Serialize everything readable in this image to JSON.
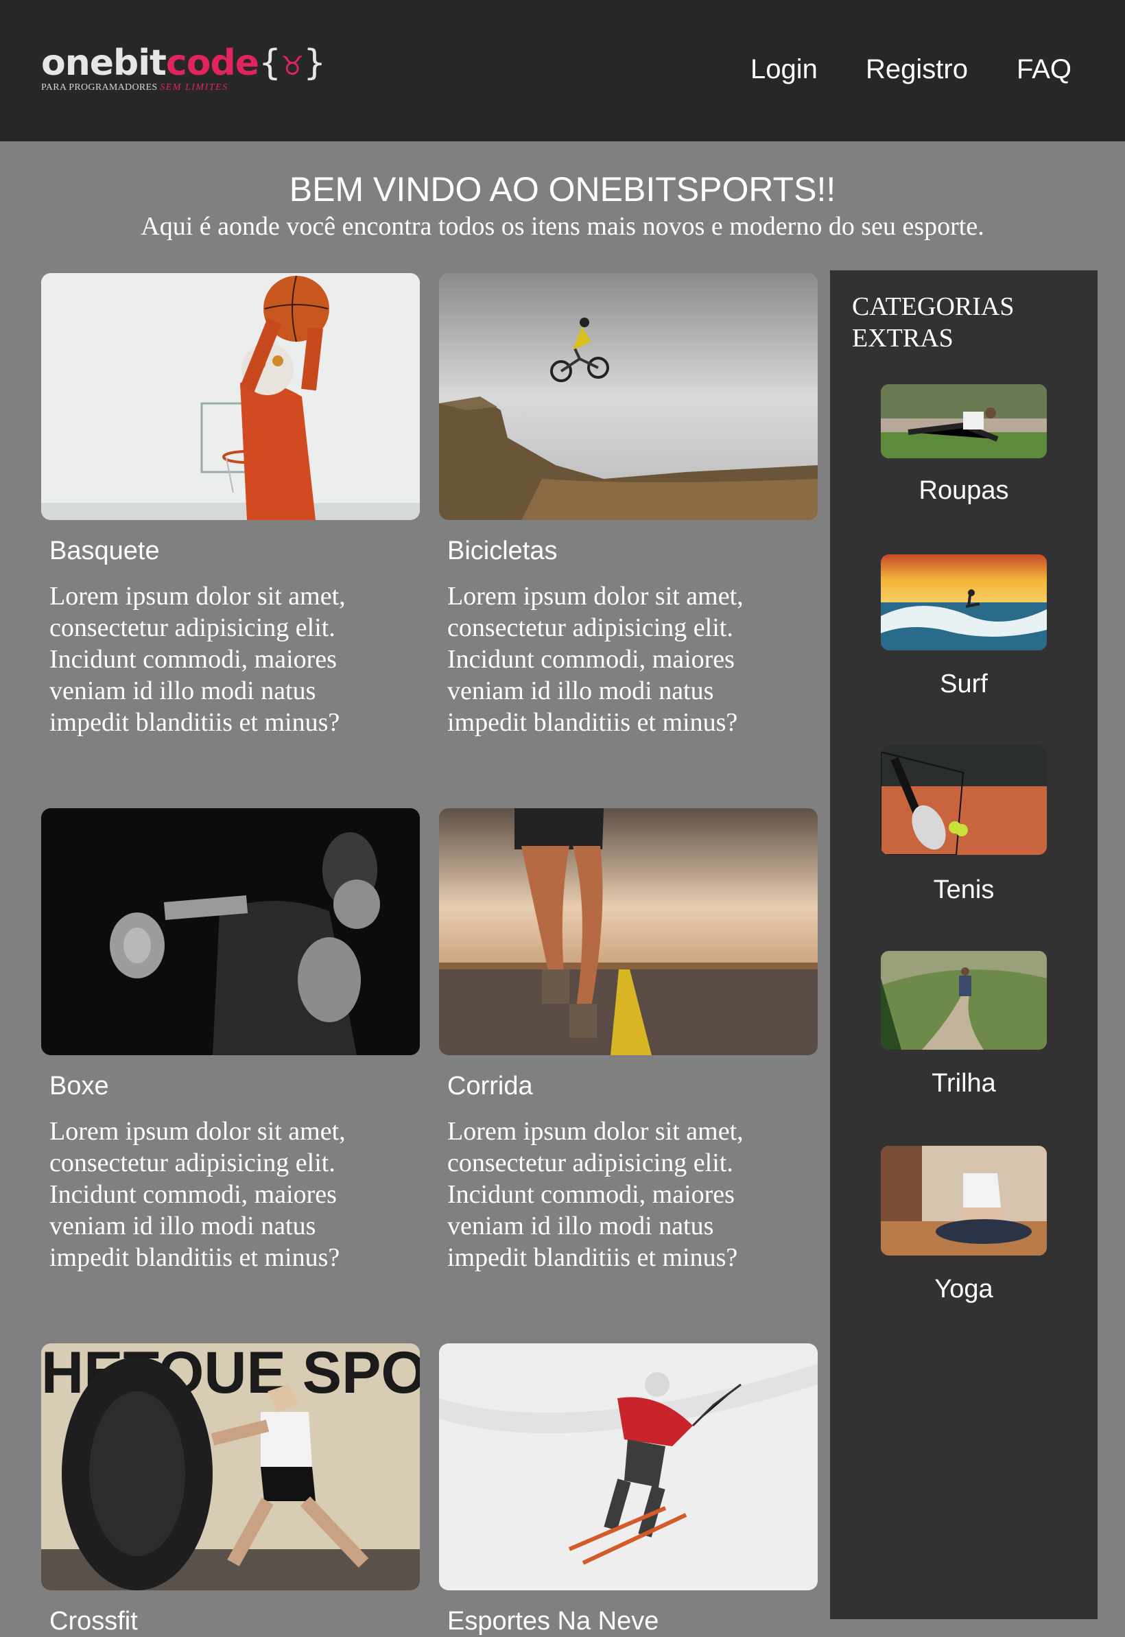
{
  "header": {
    "logo": {
      "text_one": "onebit",
      "text_code": "code",
      "brace_open": "{",
      "brace_close": "}",
      "tagline": "PARA PROGRAMADORES",
      "tagline_accent": "SEM LIMITES"
    },
    "nav": [
      {
        "label": "Login"
      },
      {
        "label": "Registro"
      },
      {
        "label": "FAQ"
      }
    ]
  },
  "intro": {
    "title": "BEM VINDO AO ONEBITSPORTS!!",
    "subtitle": "Aqui é aonde você encontra todos os itens mais novos e moderno do seu esporte."
  },
  "cards": [
    {
      "title": "Basquete",
      "text": "Lorem ipsum dolor sit amet, consectetur adipisicing elit. Incidunt commodi, maiores veniam id illo modi natus impedit blanditiis et minus?",
      "image": "basketball-photo"
    },
    {
      "title": "Bicicletas",
      "text": "Lorem ipsum dolor sit amet, consectetur adipisicing elit. Incidunt commodi, maiores veniam id illo modi natus impedit blanditiis et minus?",
      "image": "bike-jump-photo"
    },
    {
      "title": "Boxe",
      "text": "Lorem ipsum dolor sit amet, consectetur adipisicing elit. Incidunt commodi, maiores veniam id illo modi natus impedit blanditiis et minus?",
      "image": "boxing-photo"
    },
    {
      "title": "Corrida",
      "text": "Lorem ipsum dolor sit amet, consectetur adipisicing elit. Incidunt commodi, maiores veniam id illo modi natus impedit blanditiis et minus?",
      "image": "running-photo"
    },
    {
      "title": "Crossfit",
      "text": "",
      "image": "crossfit-photo",
      "image_text": "HETOUE SPOT"
    },
    {
      "title": "Esportes Na Neve",
      "text": "",
      "image": "ski-photo"
    }
  ],
  "sidebar": {
    "title": "CATEGORIAS EXTRAS",
    "items": [
      {
        "label": "Roupas",
        "image": "workout-photo"
      },
      {
        "label": "Surf",
        "image": "surf-photo"
      },
      {
        "label": "Tenis",
        "image": "tennis-photo"
      },
      {
        "label": "Trilha",
        "image": "trail-photo"
      },
      {
        "label": "Yoga",
        "image": "yoga-photo"
      }
    ]
  },
  "colors": {
    "page_bg": "#808080",
    "header_bg": "#272727",
    "sidebar_bg": "#323232",
    "brand_accent": "#e0245e",
    "text": "#ffffff"
  }
}
